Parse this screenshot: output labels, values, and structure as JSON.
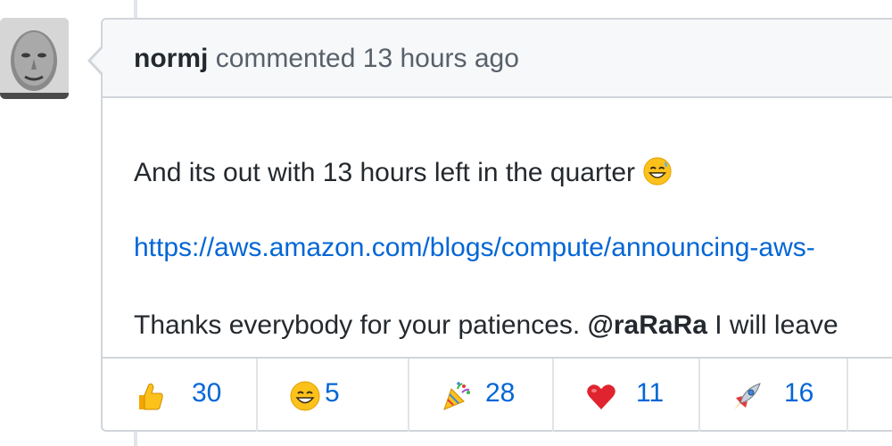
{
  "comment": {
    "author": "normj",
    "action": "commented",
    "timestamp": "13 hours ago",
    "body": {
      "line1": "And its out with 13 hours left in the quarter",
      "line1_emoji": "sweat-smile-emoji",
      "link": "https://aws.amazon.com/blogs/compute/announcing-aws-",
      "line3_prefix": "Thanks everybody for your patiences.",
      "mention": "@raRaRa",
      "line3_suffix": "I will leave"
    }
  },
  "reactions": [
    {
      "icon": "thumbs-up-emoji",
      "count": "30"
    },
    {
      "icon": "smile-emoji",
      "count": "5"
    },
    {
      "icon": "party-popper-emoji",
      "count": "28"
    },
    {
      "icon": "heart-emoji",
      "count": "11"
    },
    {
      "icon": "rocket-emoji",
      "count": "16"
    }
  ],
  "colors": {
    "link": "#0366d6",
    "border": "#d1d5da",
    "header_bg": "#f6f8fa",
    "text": "#24292e",
    "muted": "#586069"
  }
}
